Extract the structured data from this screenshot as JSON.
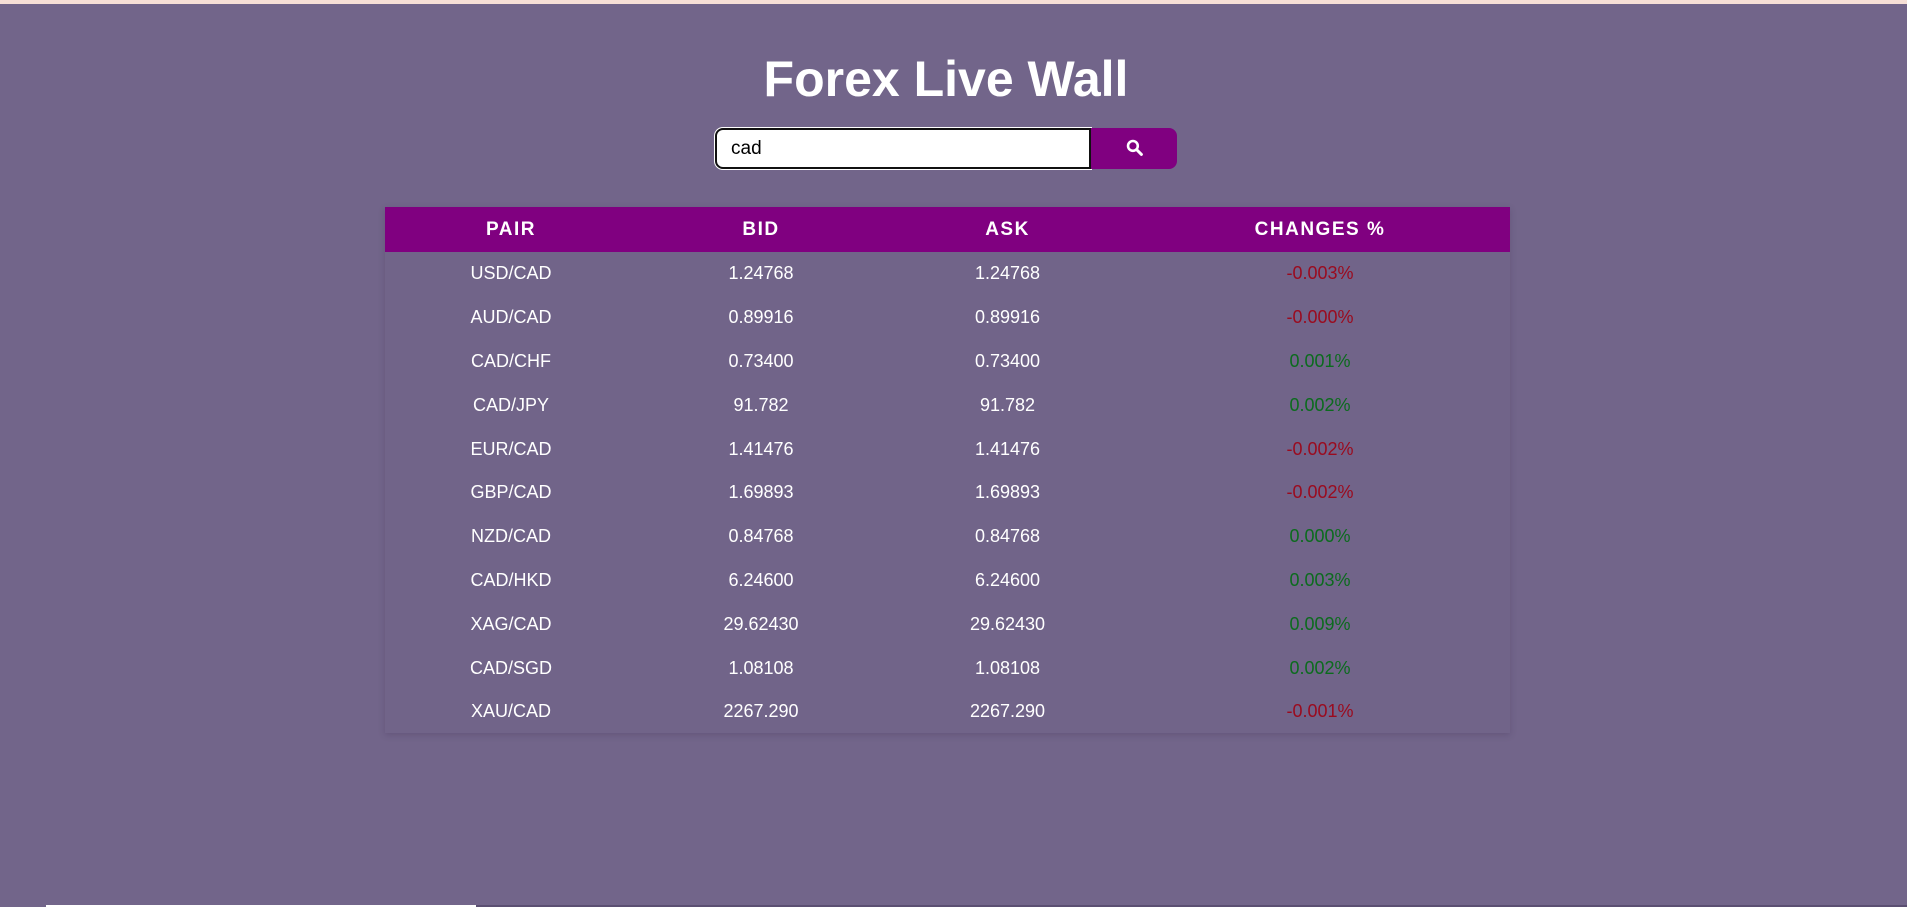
{
  "page": {
    "title": "Forex Live Wall"
  },
  "search": {
    "value": "cad",
    "placeholder": "",
    "button_icon": "search-icon"
  },
  "colors": {
    "background": "#72658a",
    "accent": "#800080",
    "negative": "#9b0a1e",
    "positive": "#0b6b1d"
  },
  "table": {
    "headers": [
      "PAIR",
      "BID",
      "ASK",
      "CHANGES %"
    ],
    "rows": [
      {
        "pair": "USD/CAD",
        "bid": "1.24768",
        "ask": "1.24768",
        "change": "-0.003%",
        "direction": "negative"
      },
      {
        "pair": "AUD/CAD",
        "bid": "0.89916",
        "ask": "0.89916",
        "change": "-0.000%",
        "direction": "negative"
      },
      {
        "pair": "CAD/CHF",
        "bid": "0.73400",
        "ask": "0.73400",
        "change": "0.001%",
        "direction": "positive"
      },
      {
        "pair": "CAD/JPY",
        "bid": "91.782",
        "ask": "91.782",
        "change": "0.002%",
        "direction": "positive"
      },
      {
        "pair": "EUR/CAD",
        "bid": "1.41476",
        "ask": "1.41476",
        "change": "-0.002%",
        "direction": "negative"
      },
      {
        "pair": "GBP/CAD",
        "bid": "1.69893",
        "ask": "1.69893",
        "change": "-0.002%",
        "direction": "negative"
      },
      {
        "pair": "NZD/CAD",
        "bid": "0.84768",
        "ask": "0.84768",
        "change": "0.000%",
        "direction": "positive"
      },
      {
        "pair": "CAD/HKD",
        "bid": "6.24600",
        "ask": "6.24600",
        "change": "0.003%",
        "direction": "positive"
      },
      {
        "pair": "XAG/CAD",
        "bid": "29.62430",
        "ask": "29.62430",
        "change": "0.009%",
        "direction": "positive"
      },
      {
        "pair": "CAD/SGD",
        "bid": "1.08108",
        "ask": "1.08108",
        "change": "0.002%",
        "direction": "positive"
      },
      {
        "pair": "XAU/CAD",
        "bid": "2267.290",
        "ask": "2267.290",
        "change": "-0.001%",
        "direction": "negative"
      }
    ]
  }
}
